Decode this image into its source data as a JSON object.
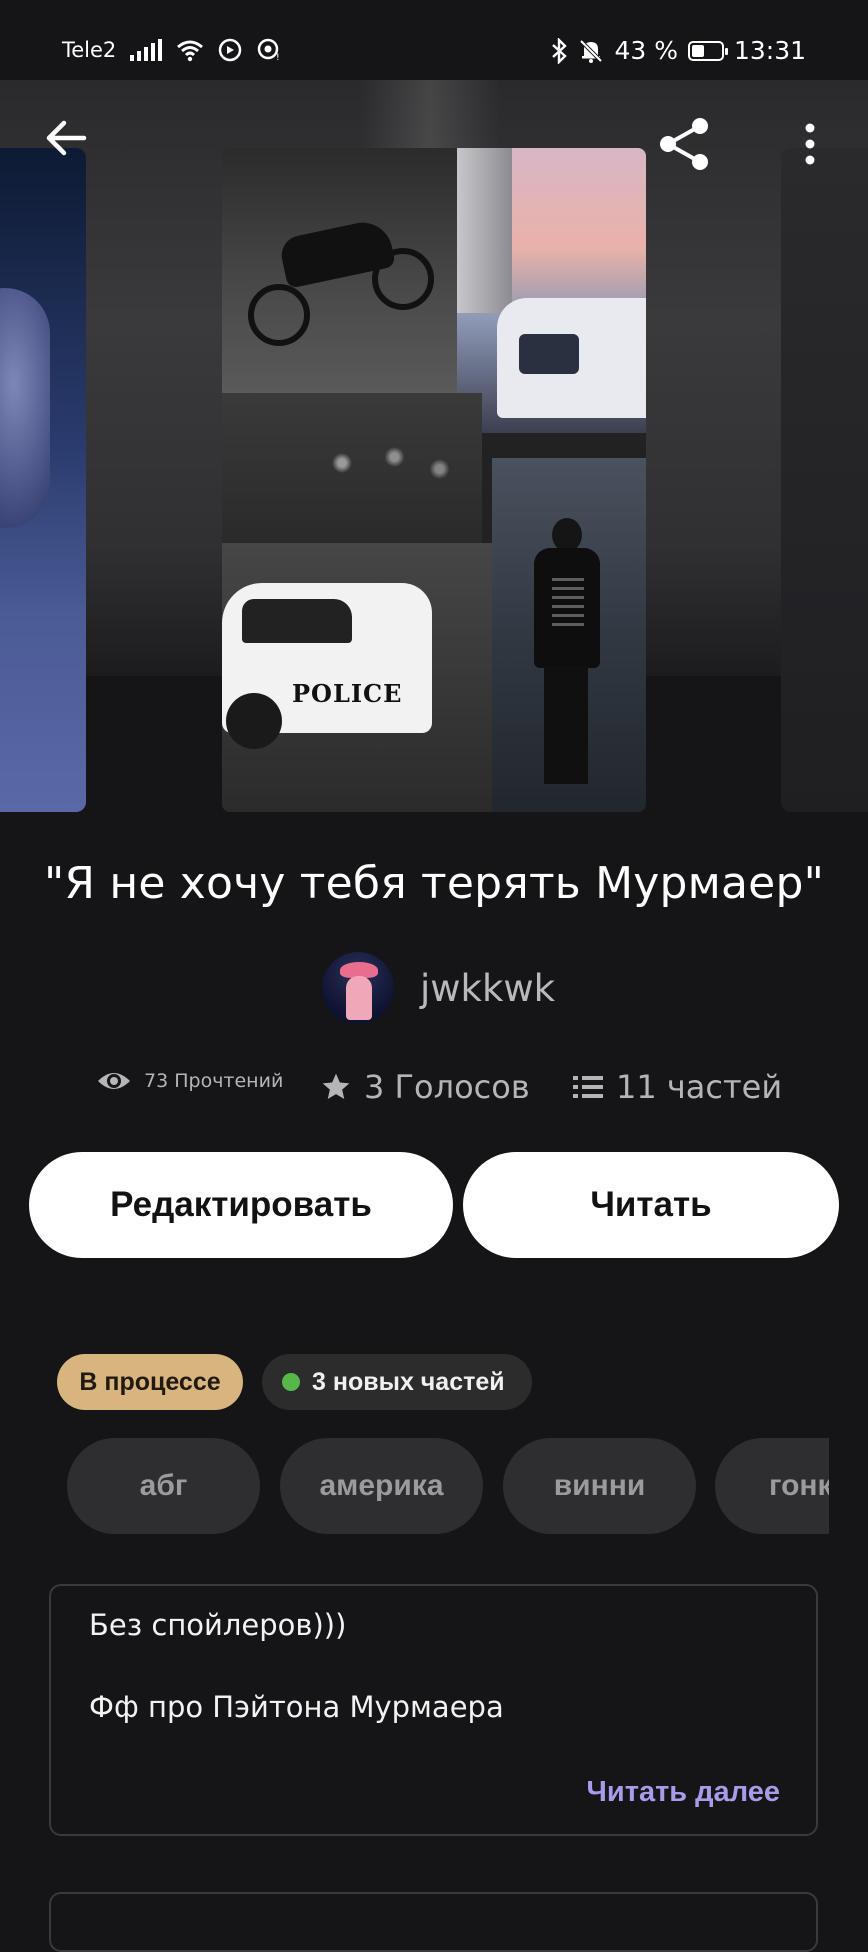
{
  "status_bar": {
    "carrier": "Tele2",
    "battery_percent": "43 %",
    "battery_level": 0.43,
    "time": "13:31"
  },
  "toolbar": {
    "back_icon": "back-arrow-icon",
    "share_icon": "share-icon",
    "more_icon": "more-vertical-icon"
  },
  "cover": {
    "text": "POLICE"
  },
  "story": {
    "title": "\"Я не хочу тебя терять Мурмаер\"",
    "author": "jwkkwk"
  },
  "stats": {
    "reads": "73 Прочтений",
    "votes": "3 Голосов",
    "parts": "11 частей"
  },
  "actions": {
    "edit_label": "Редактировать",
    "read_label": "Читать"
  },
  "badges": {
    "status": "В процессе",
    "new_parts": "3 новых частей"
  },
  "tags": [
    "абг",
    "америка",
    "винни",
    "гонк"
  ],
  "description": {
    "line1": "Без спойлеров)))",
    "line2": "Фф про Пэйтона Мурмаера",
    "read_more": "Читать далее"
  },
  "colors": {
    "background": "#151417",
    "status_badge": "#d8b47e",
    "new_dot": "#56b84a",
    "link": "#a89bea"
  }
}
